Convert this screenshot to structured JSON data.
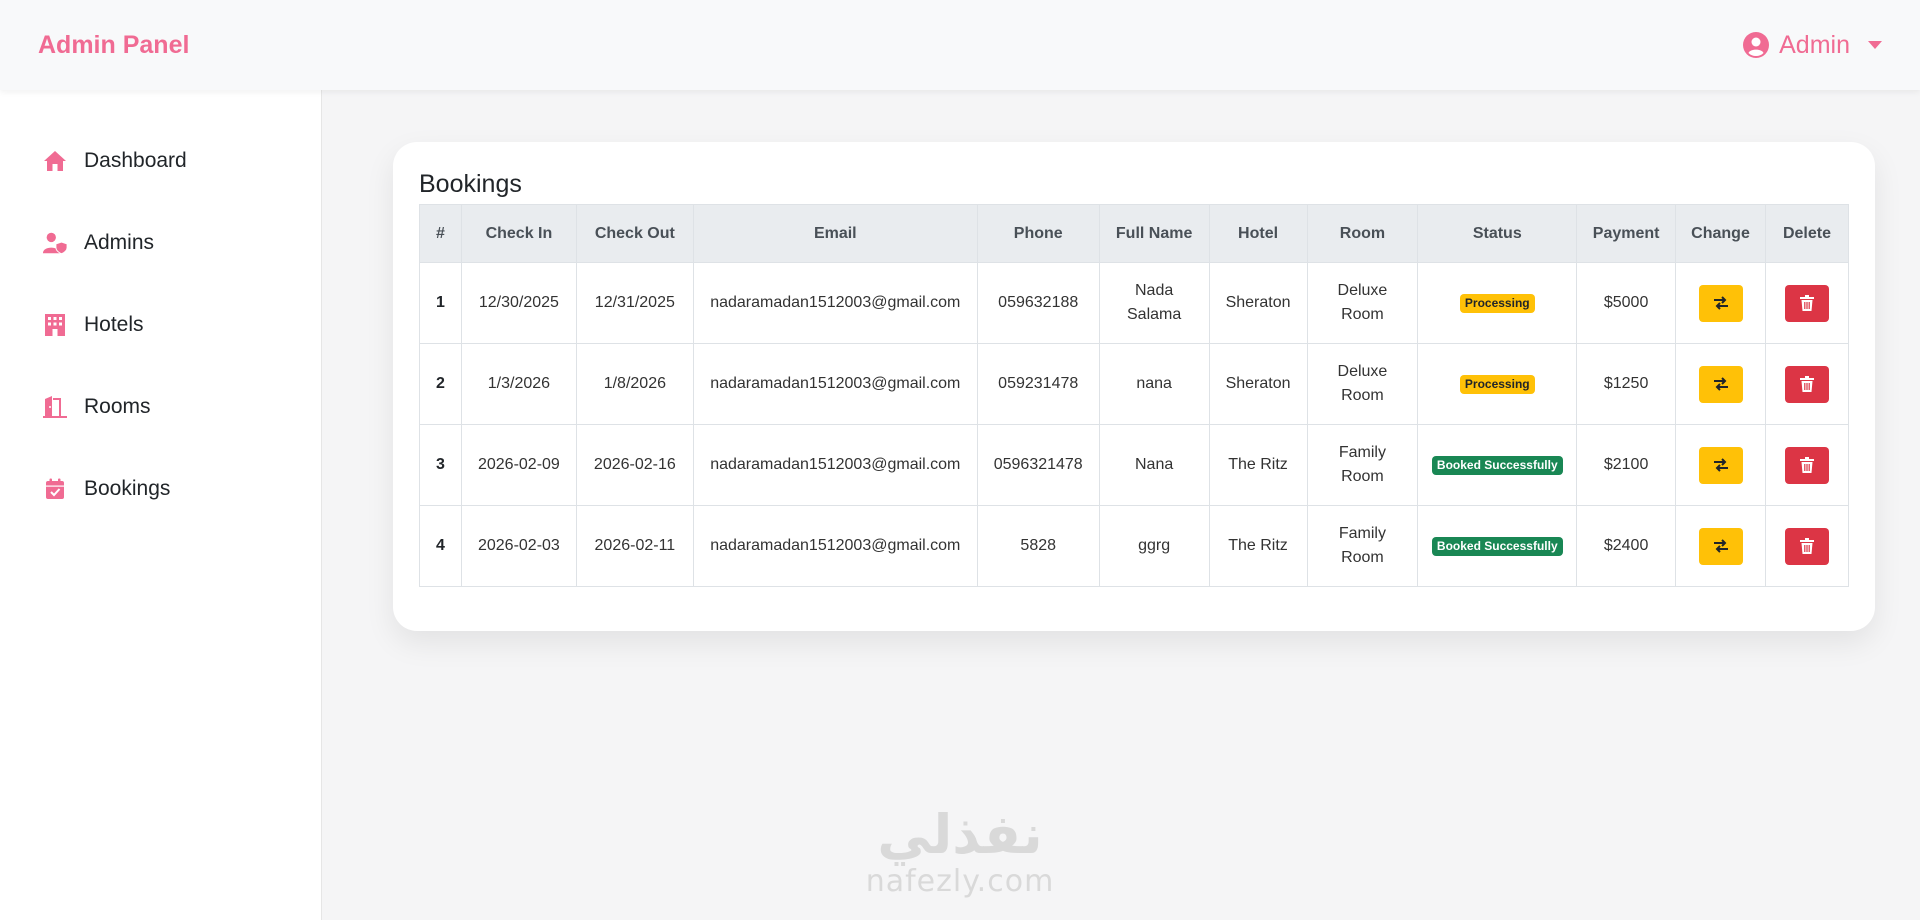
{
  "brand": "Admin Panel",
  "user": {
    "label": "Admin",
    "icon": "user-circle-icon"
  },
  "sidebar": {
    "items": [
      {
        "label": "Dashboard",
        "icon": "home-icon"
      },
      {
        "label": "Admins",
        "icon": "user-shield-icon"
      },
      {
        "label": "Hotels",
        "icon": "hotel-icon"
      },
      {
        "label": "Rooms",
        "icon": "door-open-icon"
      },
      {
        "label": "Bookings",
        "icon": "calendar-check-icon"
      }
    ]
  },
  "bookings": {
    "title": "Bookings",
    "columns": [
      "#",
      "Check In",
      "Check Out",
      "Email",
      "Phone",
      "Full Name",
      "Hotel",
      "Room",
      "Status",
      "Payment",
      "Change",
      "Delete"
    ],
    "rows": [
      {
        "idx": "1",
        "check_in": "12/30/2025",
        "check_out": "12/31/2025",
        "email": "nadaramadan1512003@gmail.com",
        "phone": "059632188",
        "full_name": "Nada Salama",
        "hotel": "Sheraton",
        "room": "Deluxe Room",
        "status": "Processing",
        "payment": "$5000"
      },
      {
        "idx": "2",
        "check_in": "1/3/2026",
        "check_out": "1/8/2026",
        "email": "nadaramadan1512003@gmail.com",
        "phone": "059231478",
        "full_name": "nana",
        "hotel": "Sheraton",
        "room": "Deluxe Room",
        "status": "Processing",
        "payment": "$1250"
      },
      {
        "idx": "3",
        "check_in": "2026-02-09",
        "check_out": "2026-02-16",
        "email": "nadaramadan1512003@gmail.com",
        "phone": "0596321478",
        "full_name": "Nana",
        "hotel": "The Ritz",
        "room": "Family Room",
        "status": "Booked Successfully",
        "payment": "$2100"
      },
      {
        "idx": "4",
        "check_in": "2026-02-03",
        "check_out": "2026-02-11",
        "email": "nadaramadan1512003@gmail.com",
        "phone": "5828",
        "full_name": "ggrg",
        "hotel": "The Ritz",
        "room": "Family Room",
        "status": "Booked Successfully",
        "payment": "$2400"
      }
    ]
  },
  "watermark": {
    "arabic": "نفذلي",
    "latin": "nafezly.com"
  },
  "colors": {
    "accent": "#f06b93",
    "warning": "#ffc107",
    "danger": "#dc3545",
    "success": "#198754"
  }
}
